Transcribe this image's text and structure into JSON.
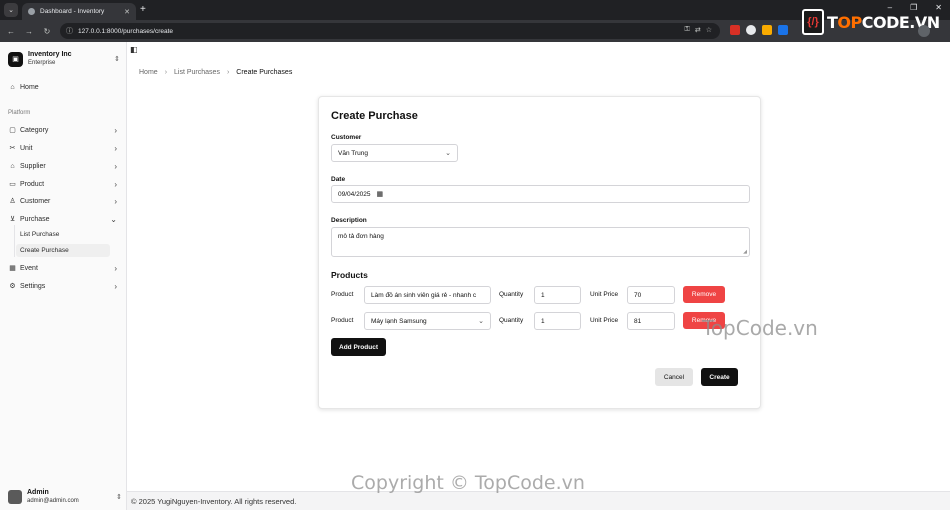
{
  "browser": {
    "tab_title": "Dashboard - Inventory",
    "url": "127.0.0.1:8000/purchases/create",
    "brand_prefix": "T",
    "brand_highlight": "OP",
    "brand_suffix": "CODE.VN"
  },
  "sidebar": {
    "org_name": "Inventory Inc",
    "org_plan": "Enterprise",
    "home": "Home",
    "section_label": "Platform",
    "items": [
      {
        "label": "Category"
      },
      {
        "label": "Unit"
      },
      {
        "label": "Supplier"
      },
      {
        "label": "Product"
      },
      {
        "label": "Customer"
      },
      {
        "label": "Purchase"
      },
      {
        "label": "Event"
      },
      {
        "label": "Settings"
      }
    ],
    "purchase_sub": [
      {
        "label": "List Purchase"
      },
      {
        "label": "Create Purchase"
      }
    ],
    "user_name": "Admin",
    "user_email": "admin@admin.com"
  },
  "breadcrumb": {
    "home": "Home",
    "list": "List Purchases",
    "current": "Create Purchases"
  },
  "form": {
    "title": "Create Purchase",
    "customer_label": "Customer",
    "customer_value": "Văn Trung",
    "date_label": "Date",
    "date_value": "09/04/2025",
    "description_label": "Description",
    "description_value": "mô tả đơn hàng",
    "products_title": "Products",
    "product_label": "Product",
    "quantity_label": "Quantity",
    "unit_price_label": "Unit Price",
    "rows": [
      {
        "product": "Làm đồ án sinh viên giá rẻ - nhanh c",
        "quantity": "1",
        "unit_price": "70",
        "remove": "Remove"
      },
      {
        "product": "Máy lạnh Samsung",
        "quantity": "1",
        "unit_price": "81",
        "remove": "Remove"
      }
    ],
    "add_product": "Add Product",
    "cancel": "Cancel",
    "create": "Create"
  },
  "footer": {
    "text": "© 2025 YugiNguyen-Inventory. All rights reserved."
  },
  "watermarks": {
    "mid": "TopCode.vn",
    "bottom": "Copyright © TopCode.vn"
  }
}
